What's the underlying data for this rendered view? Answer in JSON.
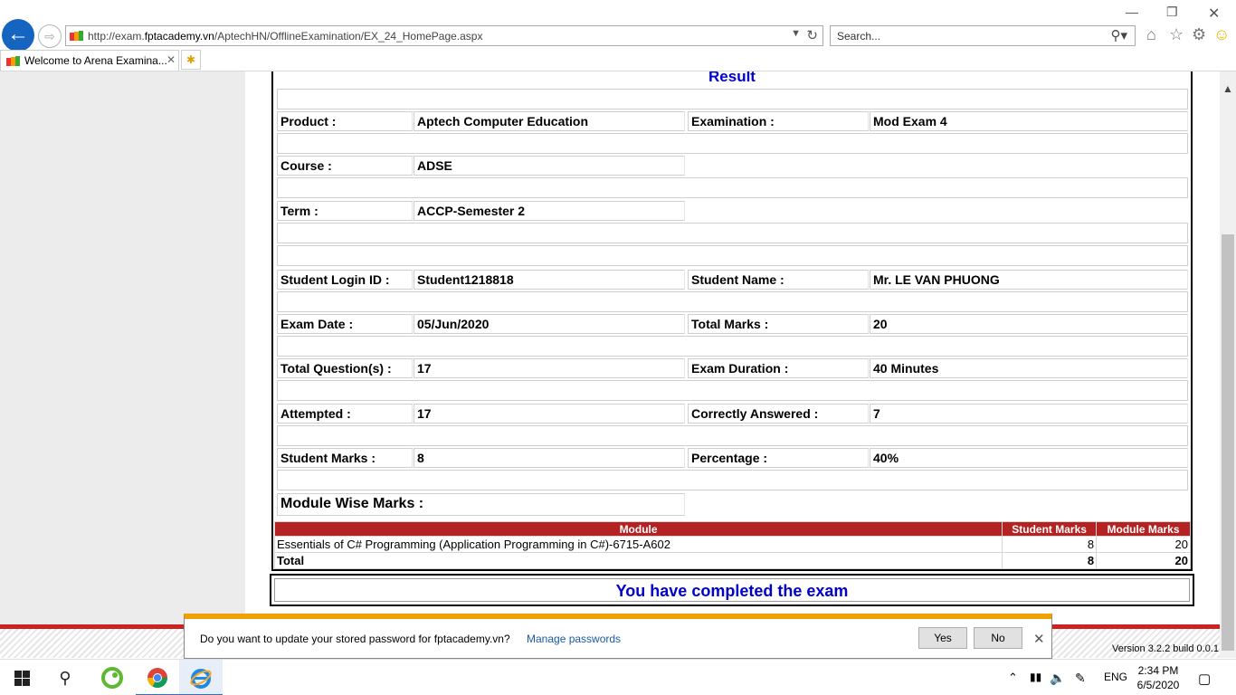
{
  "browser": {
    "url_prefix": "http://exam.",
    "url_domain": "fptacademy.vn",
    "url_path": "/AptechHN/OfflineExamination/EX_24_HomePage.aspx",
    "search_placeholder": "Search...",
    "tab_title": "Welcome to Arena Examina..."
  },
  "page": {
    "result_title": "Result",
    "labels": {
      "product": "Product :",
      "examination": "Examination :",
      "course": "Course :",
      "term": "Term :",
      "login_id": "Student Login ID :",
      "student_name": "Student Name :",
      "exam_date": "Exam Date :",
      "total_marks": "Total Marks :",
      "total_questions": "Total Question(s) :",
      "exam_duration": "Exam Duration :",
      "attempted": "Attempted :",
      "correctly_answered": "Correctly Answered :",
      "student_marks": "Student Marks :",
      "percentage": "Percentage :",
      "module_wise_marks": "Module Wise Marks :"
    },
    "values": {
      "product": "Aptech Computer Education",
      "examination": "Mod Exam 4",
      "course": "ADSE",
      "term": "ACCP-Semester 2",
      "login_id": "Student1218818",
      "student_name": "Mr. LE VAN PHUONG",
      "exam_date": "05/Jun/2020",
      "total_marks": "20",
      "total_questions": "17",
      "exam_duration": "40 Minutes",
      "attempted": "17",
      "correctly_answered": "7",
      "student_marks": "8",
      "percentage": "40%"
    },
    "module_table": {
      "headers": {
        "module": "Module",
        "student_marks": "Student Marks",
        "module_marks": "Module Marks"
      },
      "rows": [
        {
          "module": "Essentials of C# Programming (Application Programming in C#)-6715-A602",
          "student_marks": "8",
          "module_marks": "20"
        }
      ],
      "total": {
        "label": "Total",
        "student_marks": "8",
        "module_marks": "20"
      }
    },
    "completion_message": "You have completed the exam",
    "version": "Version 3.2.2 build 0.0.1"
  },
  "notification": {
    "message": "Do you want to update your stored password for fptacademy.vn?",
    "link": "Manage passwords",
    "yes": "Yes",
    "no": "No"
  },
  "taskbar": {
    "language": "ENG",
    "time": "2:34 PM",
    "date": "6/5/2020"
  }
}
